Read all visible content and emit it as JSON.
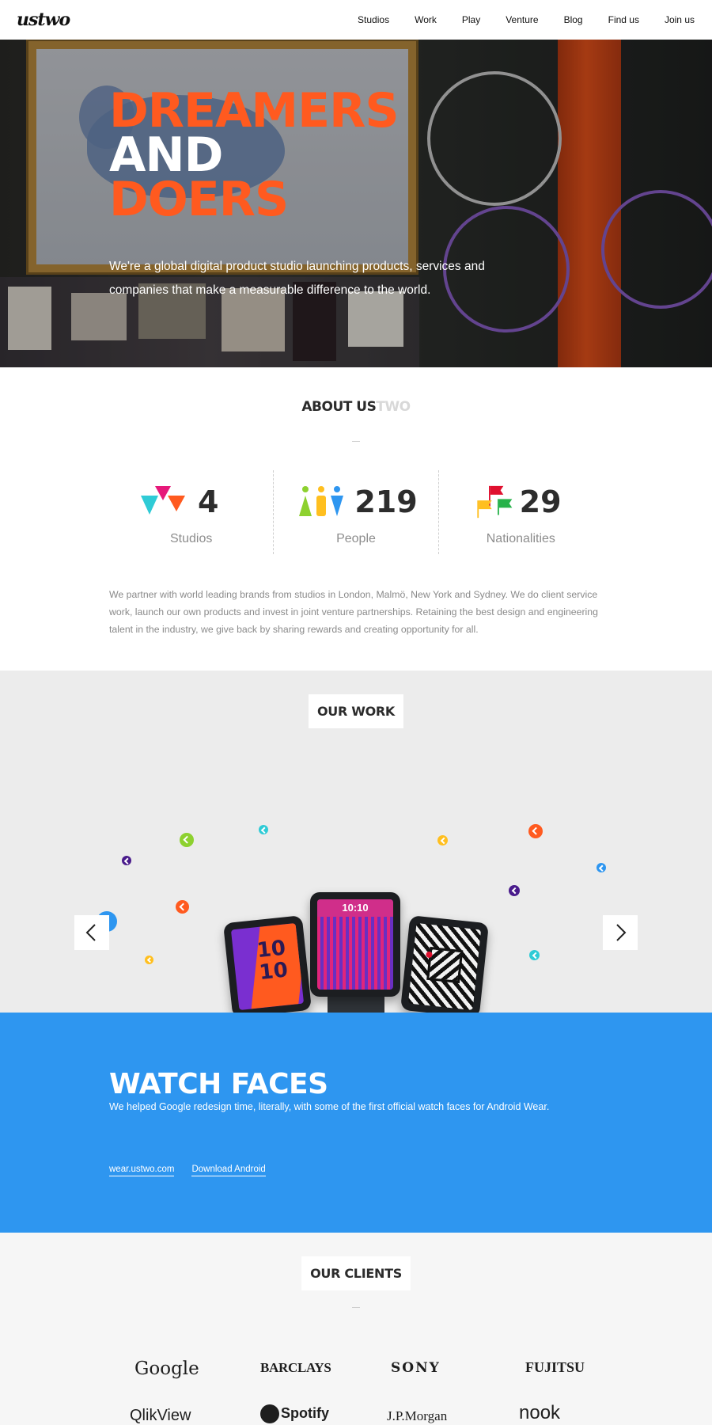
{
  "nav": {
    "logo": "ustwo",
    "links": [
      "Studios",
      "Work",
      "Play",
      "Venture",
      "Blog",
      "Find us",
      "Join us"
    ]
  },
  "hero": {
    "title_line1": "DREAMERS",
    "title_line2": "AND",
    "title_line3": "DOERS",
    "text": "We're a global digital product studio launching products, services and companies that make a measurable difference to the world."
  },
  "about": {
    "title_a": "ABOUT US",
    "title_b": "TWO",
    "stats": [
      {
        "value": "4",
        "label": "Studios",
        "icon": "triangles-icon"
      },
      {
        "value": "219",
        "label": "People",
        "icon": "people-icon"
      },
      {
        "value": "29",
        "label": "Nationalities",
        "icon": "flags-icon"
      }
    ],
    "text": "We partner with world leading brands from studios in London, Malmö, New York and Sydney. We do client service work, launch our own products and invest in joint venture partnerships. Retaining the best design and engineering talent in the industry, we give back by sharing rewards and creating opportunity for all."
  },
  "work": {
    "title": "OUR WORK",
    "watch_time": "10:10",
    "watch_hours": "10",
    "watch_minutes": "10",
    "feature_title": "WATCH FACES",
    "feature_text": "We helped Google redesign time, literally, with some of the first official watch faces for Android Wear.",
    "links": [
      "wear.ustwo.com",
      "Download Android"
    ]
  },
  "clients": {
    "title": "OUR CLIENTS",
    "logos": [
      "Google",
      "BARCLAYS",
      "SONY",
      "FUJITSU",
      "QlikView",
      "Spotify",
      "J.P.Morgan",
      "nook"
    ]
  },
  "colors": {
    "accent_orange": "#ff5a1f",
    "feature_blue": "#2e96f0"
  }
}
